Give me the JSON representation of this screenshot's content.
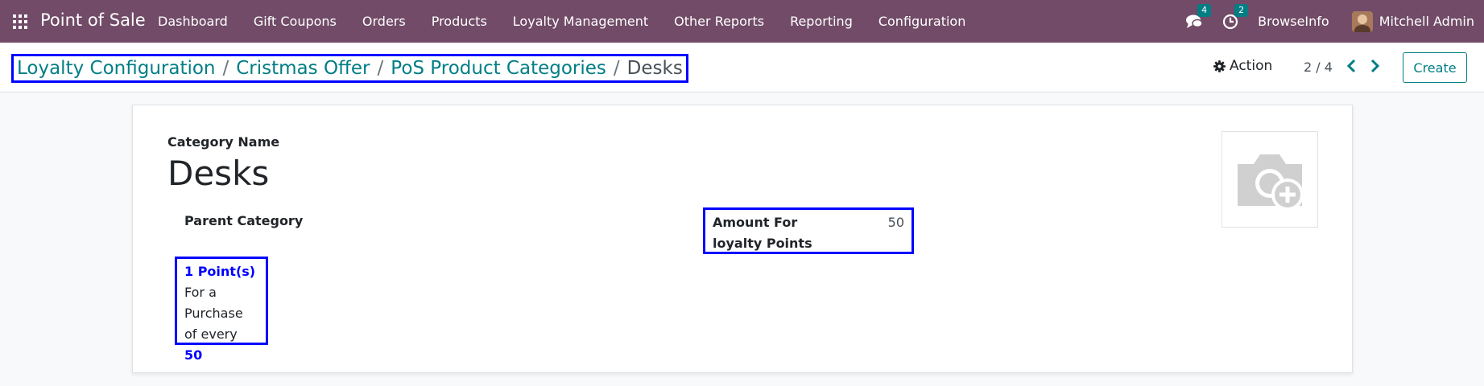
{
  "navbar": {
    "brand": "Point of Sale",
    "menu": [
      "Dashboard",
      "Gift Coupons",
      "Orders",
      "Products",
      "Loyalty Management",
      "Other Reports",
      "Reporting",
      "Configuration"
    ],
    "messages_count": "4",
    "activities_count": "2",
    "company": "BrowseInfo",
    "user": "Mitchell Admin"
  },
  "control_panel": {
    "breadcrumb": [
      "Loyalty Configuration",
      "Cristmas Offer",
      "PoS Product Categories"
    ],
    "breadcrumb_separator": "/",
    "breadcrumb_active": "Desks",
    "action_label": "Action",
    "pager_value": "2 / 4",
    "create_label": "Create"
  },
  "form": {
    "category_name_label": "Category Name",
    "category_name": "Desks",
    "parent_category_label": "Parent Category",
    "loyalty_points": "1 Point(s)",
    "purchase_text": "For a Purchase of every",
    "purchase_amount": "50",
    "amount_label": "Amount For loyalty Points",
    "amount_value": "50"
  },
  "colors": {
    "navbar": "#714b67",
    "accent": "#017e84",
    "highlight": "#0000ff"
  }
}
